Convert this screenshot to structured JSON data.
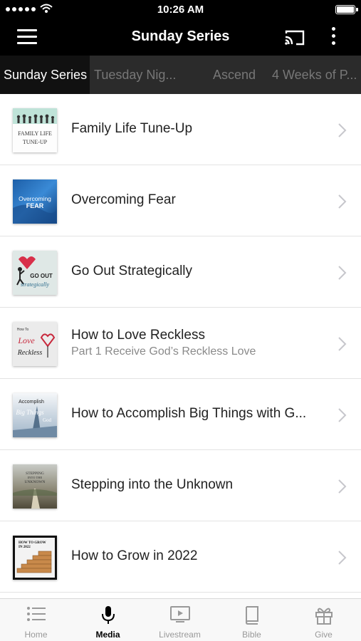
{
  "status_bar": {
    "time": "10:26 AM"
  },
  "nav": {
    "title": "Sunday Series"
  },
  "tabs": [
    {
      "label": "Sunday Series"
    },
    {
      "label": "Tuesday Nig..."
    },
    {
      "label": "Ascend"
    },
    {
      "label": "4 Weeks of P..."
    }
  ],
  "items": [
    {
      "title": "Family Life Tune-Up",
      "subtitle": "",
      "thumb_text": [
        "FAMILY LIFE",
        "TUNE-UP"
      ]
    },
    {
      "title": "Overcoming Fear",
      "subtitle": "",
      "thumb_text": [
        "Overcoming",
        "FEAR"
      ]
    },
    {
      "title": "Go Out Strategically",
      "subtitle": "",
      "thumb_text": [
        "GO OUT",
        "strategically"
      ]
    },
    {
      "title": "How to Love Reckless",
      "subtitle": "Part 1 Receive God’s Reckless Love",
      "thumb_text": [
        "How To",
        "Love",
        "Reckless"
      ]
    },
    {
      "title": "How to Accomplish Big Things with G...",
      "subtitle": "",
      "thumb_text": [
        "Accomplish",
        "Big Things",
        "God"
      ]
    },
    {
      "title": "Stepping into the Unknown",
      "subtitle": "",
      "thumb_text": [
        "STEPPING",
        "INTO THE",
        "UNKNOWN"
      ]
    },
    {
      "title": "How to Grow in 2022",
      "subtitle": "",
      "thumb_text": [
        "HOW TO GROW",
        "IN 2022"
      ]
    }
  ],
  "tab_bar": [
    {
      "label": "Home",
      "icon": "list-icon"
    },
    {
      "label": "Media",
      "icon": "microphone-icon"
    },
    {
      "label": "Livestream",
      "icon": "tv-play-icon"
    },
    {
      "label": "Bible",
      "icon": "book-icon"
    },
    {
      "label": "Give",
      "icon": "gift-icon"
    }
  ],
  "colors": {
    "bar_bg": "#000000",
    "tabs_bg": "#2b2b2b",
    "tab_active_bg": "#111111",
    "tab_inactive_text": "#777777"
  }
}
